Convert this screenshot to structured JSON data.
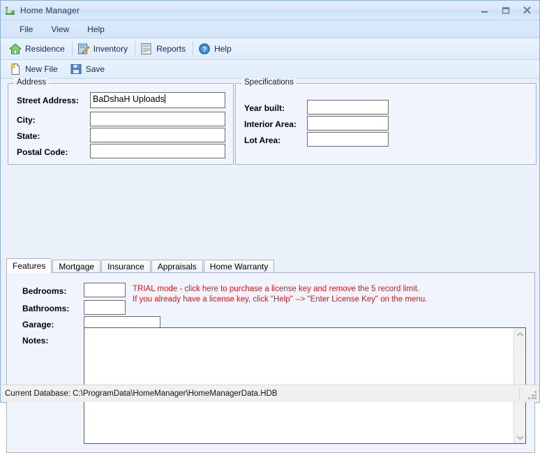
{
  "window": {
    "title": "Home Manager",
    "icon": "app-building-icon",
    "controls": [
      {
        "name": "minimize-button",
        "glyph": "minimize"
      },
      {
        "name": "maximize-button",
        "glyph": "maximize"
      },
      {
        "name": "close-button",
        "glyph": "close"
      }
    ]
  },
  "menubar": {
    "items": [
      {
        "label": "File"
      },
      {
        "label": "View"
      },
      {
        "label": "Help"
      }
    ]
  },
  "toolbar_main": {
    "items": [
      {
        "label": "Residence",
        "icon": "house-icon"
      },
      {
        "label": "Inventory",
        "icon": "notepad-pencil-icon"
      },
      {
        "label": "Reports",
        "icon": "report-document-icon"
      },
      {
        "label": "Help",
        "icon": "question-circle-icon"
      }
    ]
  },
  "toolbar_file": {
    "items": [
      {
        "label": "New File",
        "icon": "new-file-icon"
      },
      {
        "label": "Save",
        "icon": "floppy-disk-icon"
      }
    ]
  },
  "address_group": {
    "title": "Address",
    "fields": [
      {
        "label": "Street Address:",
        "value": "BaDshaH Uploads",
        "focused": true
      },
      {
        "label": "City:",
        "value": ""
      },
      {
        "label": "State:",
        "value": ""
      },
      {
        "label": "Postal Code:",
        "value": ""
      }
    ]
  },
  "specifications_group": {
    "title": "Specifications",
    "fields": [
      {
        "label": "Year built:",
        "value": ""
      },
      {
        "label": "Interior Area:",
        "value": ""
      },
      {
        "label": "Lot Area:",
        "value": ""
      }
    ]
  },
  "tabs": {
    "selected": "Features",
    "items": [
      {
        "label": "Features"
      },
      {
        "label": "Mortgage"
      },
      {
        "label": "Insurance"
      },
      {
        "label": "Appraisals"
      },
      {
        "label": "Home Warranty"
      }
    ]
  },
  "features_panel": {
    "fields": [
      {
        "label": "Bedrooms:",
        "value": ""
      },
      {
        "label": "Bathrooms:",
        "value": ""
      },
      {
        "label": "Garage:",
        "value": ""
      },
      {
        "label": "Notes:",
        "value": ""
      }
    ],
    "trial_line1": "TRIAL mode -  click here to purchase a license key and remove the 5 record limit.",
    "trial_line2": "If you already have a license key, click \"Help\" --> \"Enter License Key\" on the menu.",
    "trial_color": "#e81313"
  },
  "statusbar": {
    "text": "Current Database: C:\\ProgramData\\HomeManager\\HomeManagerData.HDB"
  },
  "colors": {
    "window_chrome": "#dcebfb",
    "panel_bg": "#eff4fd",
    "client_bg": "#eaf1fb",
    "accent_blue": "#1a3a6b"
  }
}
